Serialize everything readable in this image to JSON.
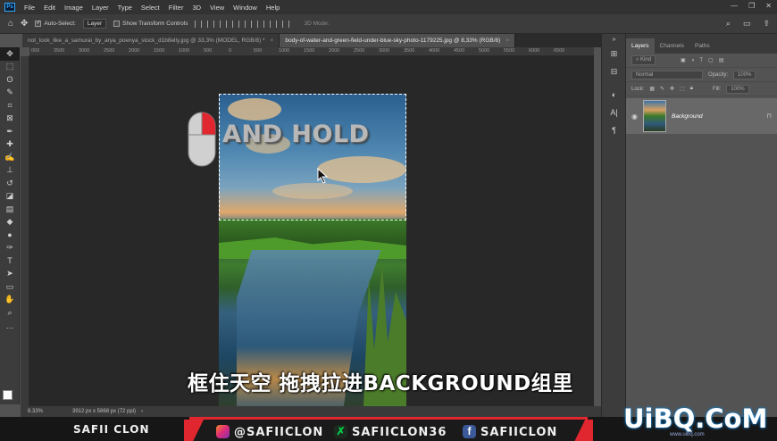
{
  "menubar": {
    "logo": "Ps",
    "items": [
      "File",
      "Edit",
      "Image",
      "Layer",
      "Type",
      "Select",
      "Filter",
      "3D",
      "View",
      "Window",
      "Help"
    ],
    "window_controls": [
      "—",
      "❐",
      "✕"
    ]
  },
  "options": {
    "auto_select_label": "Auto-Select:",
    "auto_select_value": "Layer",
    "transform_label": "Show Transform Controls",
    "mode_label": "3D Mode:"
  },
  "tabs": [
    {
      "label": "not_look_like_a_samurai_by_arya_poenya_stock_d1b8elly.jpg @ 33,3% (MODEL, RGB/8) *",
      "active": false
    },
    {
      "label": "body-of-water-and-green-field-under-blue-sky-photo-1179225.jpg @ 8,33% (RGB/8)",
      "active": true
    }
  ],
  "ruler": {
    "top_labels": [
      "000",
      "3500",
      "3000",
      "2500",
      "2000",
      "1500",
      "1000",
      "500",
      "0",
      "500",
      "1000",
      "1500",
      "2000",
      "2500",
      "3000",
      "3500",
      "4000",
      "4500",
      "5000",
      "5500",
      "6000",
      "6500"
    ]
  },
  "canvas": {
    "overlay_text": "AND HOLD"
  },
  "subtitle": "框住天空 拖拽拉进BACKGROUND组里",
  "status": {
    "zoom": "8.33%",
    "dimensions": "3912 px x 5868 px (72 ppi)"
  },
  "panel": {
    "tabs": [
      "Layers",
      "Channels",
      "Paths"
    ],
    "kind_label": "Kind",
    "blend_mode": "Normal",
    "opacity_label": "Opacity:",
    "opacity_value": "100%",
    "lock_label": "Lock:",
    "fill_label": "Fill:",
    "fill_value": "100%",
    "layer_name": "Background"
  },
  "banner": {
    "left_name": "SAFII CLON",
    "instagram": "@SAFIICLON",
    "deviantart": "SAFIICLON36",
    "facebook": "SAFIICLON"
  },
  "watermark": {
    "text": "UiBQ.CoM",
    "sub": "www.uibq.com"
  },
  "colors": {
    "accent_red": "#e0262e",
    "ps_blue": "#31a8ff",
    "instagram": "#c13584",
    "facebook": "#3b5998",
    "deviantart": "#05cc47"
  }
}
